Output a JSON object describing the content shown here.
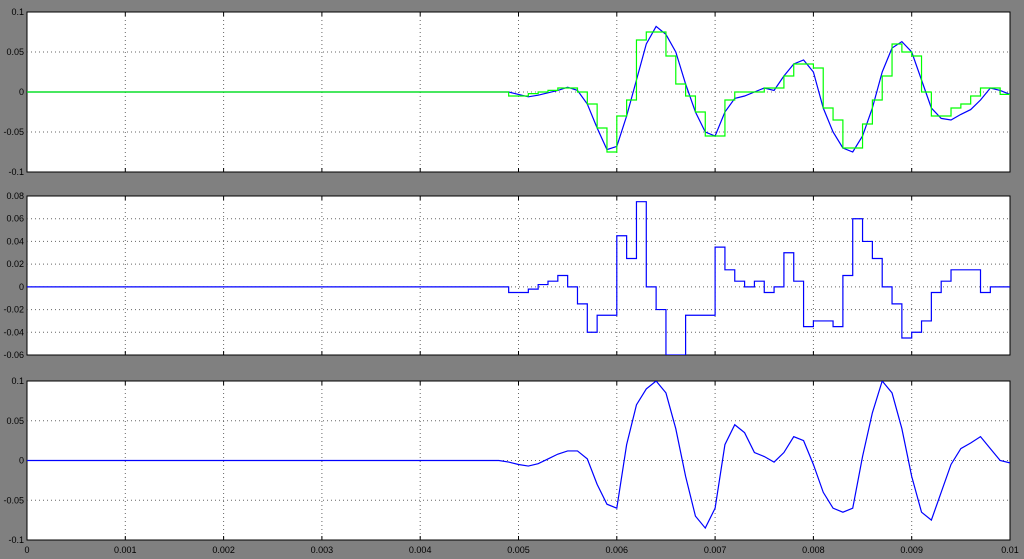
{
  "colors": {
    "background": "#808080",
    "plot_bg": "#ffffff",
    "grid": "#666666",
    "blue": "#0000ff",
    "green": "#00ff00"
  },
  "chart_data": [
    {
      "type": "line",
      "title": "",
      "xlim": [
        0,
        0.01
      ],
      "ylim": [
        -0.1,
        0.1
      ],
      "yticks": [
        "0.1",
        "0.05",
        "0",
        "-0.05",
        "-0.1"
      ],
      "ytick_values": [
        0.1,
        0.05,
        0,
        -0.05,
        -0.1
      ],
      "xticks": [
        0,
        0.001,
        0.002,
        0.003,
        0.004,
        0.005,
        0.006,
        0.007,
        0.008,
        0.009,
        0.01
      ],
      "grid": true,
      "series": [
        {
          "style": "line",
          "color": "#0000ff",
          "x": [
            0,
            0.0005,
            0.001,
            0.002,
            0.003,
            0.004,
            0.0048,
            0.0049,
            0.005,
            0.0051,
            0.0052,
            0.0053,
            0.0054,
            0.0055,
            0.0056,
            0.0057,
            0.0058,
            0.0059,
            0.006,
            0.0061,
            0.0062,
            0.0063,
            0.0064,
            0.0065,
            0.0066,
            0.0067,
            0.0068,
            0.0069,
            0.007,
            0.0071,
            0.0072,
            0.0073,
            0.0074,
            0.0075,
            0.0076,
            0.0077,
            0.0078,
            0.0079,
            0.008,
            0.0081,
            0.0082,
            0.0083,
            0.0084,
            0.0085,
            0.0086,
            0.0087,
            0.0088,
            0.0089,
            0.009,
            0.0091,
            0.0092,
            0.0093,
            0.0094,
            0.0095,
            0.0096,
            0.0097,
            0.0098,
            0.0099,
            0.01
          ],
          "y": [
            0,
            0,
            0,
            0,
            0,
            0,
            0,
            0,
            -0.003,
            -0.006,
            -0.004,
            -0.001,
            0.002,
            0.006,
            0.002,
            -0.015,
            -0.045,
            -0.072,
            -0.068,
            -0.03,
            0.015,
            0.06,
            0.082,
            0.072,
            0.05,
            0.01,
            -0.025,
            -0.05,
            -0.055,
            -0.025,
            -0.008,
            -0.005,
            0,
            0.005,
            0.002,
            0.02,
            0.035,
            0.04,
            0.025,
            -0.02,
            -0.05,
            -0.07,
            -0.075,
            -0.055,
            -0.02,
            0.025,
            0.055,
            0.063,
            0.05,
            0.015,
            -0.02,
            -0.033,
            -0.035,
            -0.028,
            -0.022,
            -0.01,
            0.005,
            0.002,
            -0.003
          ]
        },
        {
          "style": "step",
          "color": "#00ff00",
          "x": [
            0,
            0.004,
            0.0049,
            0.005,
            0.0051,
            0.0052,
            0.0053,
            0.0054,
            0.0055,
            0.0056,
            0.0057,
            0.0058,
            0.0059,
            0.006,
            0.0061,
            0.0062,
            0.0063,
            0.0064,
            0.0065,
            0.0066,
            0.0067,
            0.0068,
            0.0069,
            0.007,
            0.0071,
            0.0072,
            0.0073,
            0.0074,
            0.0075,
            0.0076,
            0.0077,
            0.0078,
            0.0079,
            0.008,
            0.0081,
            0.0082,
            0.0083,
            0.0084,
            0.0085,
            0.0086,
            0.0087,
            0.0088,
            0.0089,
            0.009,
            0.0091,
            0.0092,
            0.0093,
            0.0094,
            0.0095,
            0.0096,
            0.0097,
            0.0098,
            0.0099
          ],
          "y": [
            0,
            0,
            -0.005,
            -0.005,
            -0.002,
            0,
            0.002,
            0.005,
            0.005,
            0,
            -0.015,
            -0.045,
            -0.075,
            -0.03,
            -0.01,
            0.065,
            0.075,
            0.075,
            0.045,
            0.01,
            -0.005,
            -0.025,
            -0.055,
            -0.055,
            -0.01,
            0,
            0,
            0,
            0.005,
            0.005,
            0.02,
            0.035,
            0.035,
            0.03,
            -0.02,
            -0.035,
            -0.07,
            -0.07,
            -0.04,
            -0.01,
            0.02,
            0.06,
            0.05,
            0.045,
            0,
            -0.03,
            -0.03,
            -0.02,
            -0.015,
            -0.005,
            0.005,
            0.005,
            -0.003
          ]
        }
      ]
    },
    {
      "type": "line",
      "title": "",
      "xlim": [
        0,
        0.01
      ],
      "ylim": [
        -0.06,
        0.08
      ],
      "yticks": [
        "0.08",
        "0.06",
        "0.04",
        "0.02",
        "0",
        "-0.02",
        "-0.04",
        "-0.06"
      ],
      "ytick_values": [
        0.08,
        0.06,
        0.04,
        0.02,
        0,
        -0.02,
        -0.04,
        -0.06
      ],
      "xticks": [
        0,
        0.001,
        0.002,
        0.003,
        0.004,
        0.005,
        0.006,
        0.007,
        0.008,
        0.009,
        0.01
      ],
      "grid": true,
      "series": [
        {
          "style": "step",
          "color": "#0000ff",
          "x": [
            0,
            0.0049,
            0.005,
            0.0051,
            0.0052,
            0.0053,
            0.0054,
            0.0055,
            0.0056,
            0.0057,
            0.0058,
            0.0059,
            0.006,
            0.0061,
            0.0062,
            0.0063,
            0.0064,
            0.0065,
            0.0066,
            0.0067,
            0.0068,
            0.0069,
            0.007,
            0.0071,
            0.0072,
            0.0073,
            0.0074,
            0.0075,
            0.0076,
            0.0077,
            0.0078,
            0.0079,
            0.008,
            0.0081,
            0.0082,
            0.0083,
            0.0084,
            0.0085,
            0.0086,
            0.0087,
            0.0088,
            0.0089,
            0.009,
            0.0091,
            0.0092,
            0.0093,
            0.0094,
            0.0095,
            0.0096,
            0.0097,
            0.0098,
            0.0099,
            0.01
          ],
          "y": [
            0,
            -0.005,
            -0.005,
            -0.002,
            0.002,
            0.005,
            0.01,
            0.0,
            -0.015,
            -0.04,
            -0.025,
            -0.025,
            0.045,
            0.025,
            0.075,
            0.0,
            -0.02,
            -0.06,
            -0.06,
            -0.025,
            -0.025,
            -0.025,
            0.035,
            0.015,
            0.005,
            0.0,
            0.005,
            -0.005,
            0.0,
            0.03,
            0.005,
            -0.035,
            -0.03,
            -0.03,
            -0.035,
            0.01,
            0.06,
            0.04,
            0.025,
            0.0,
            -0.015,
            -0.045,
            -0.04,
            -0.03,
            -0.005,
            0.005,
            0.015,
            0.015,
            0.015,
            -0.005,
            0.0,
            0.0,
            0.0
          ]
        }
      ]
    },
    {
      "type": "line",
      "title": "",
      "xlim": [
        0,
        0.01
      ],
      "ylim": [
        -0.1,
        0.1
      ],
      "yticks": [
        "0.1",
        "0.05",
        "0",
        "-0.05",
        "-0.1"
      ],
      "ytick_values": [
        0.1,
        0.05,
        0,
        -0.05,
        -0.1
      ],
      "xticks": [
        0,
        0.001,
        0.002,
        0.003,
        0.004,
        0.005,
        0.006,
        0.007,
        0.008,
        0.009,
        0.01
      ],
      "xticklabels": [
        "0",
        "0.001",
        "0.002",
        "0.003",
        "0.004",
        "0.005",
        "0.006",
        "0.007",
        "0.008",
        "0.009",
        "0.01"
      ],
      "grid": true,
      "series": [
        {
          "style": "line",
          "color": "#0000ff",
          "x": [
            0,
            0.0048,
            0.0049,
            0.005,
            0.0051,
            0.0052,
            0.0053,
            0.0054,
            0.0055,
            0.0056,
            0.0057,
            0.0058,
            0.0059,
            0.006,
            0.0061,
            0.0062,
            0.0063,
            0.0064,
            0.0065,
            0.0066,
            0.0067,
            0.0068,
            0.0069,
            0.007,
            0.0071,
            0.0072,
            0.0073,
            0.0074,
            0.0075,
            0.0076,
            0.0077,
            0.0078,
            0.0079,
            0.008,
            0.0081,
            0.0082,
            0.0083,
            0.0084,
            0.0085,
            0.0086,
            0.0087,
            0.0088,
            0.0089,
            0.009,
            0.0091,
            0.0092,
            0.0093,
            0.0094,
            0.0095,
            0.0096,
            0.0097,
            0.0098,
            0.0099,
            0.01
          ],
          "y": [
            0,
            0,
            -0.002,
            -0.005,
            -0.007,
            -0.004,
            0.002,
            0.008,
            0.012,
            0.012,
            0.002,
            -0.03,
            -0.055,
            -0.06,
            0.02,
            0.07,
            0.09,
            0.1,
            0.085,
            0.04,
            -0.02,
            -0.07,
            -0.085,
            -0.06,
            0.02,
            0.045,
            0.035,
            0.01,
            0.005,
            -0.002,
            0.01,
            0.03,
            0.025,
            -0.005,
            -0.04,
            -0.06,
            -0.065,
            -0.06,
            0.005,
            0.06,
            0.1,
            0.085,
            0.04,
            -0.02,
            -0.065,
            -0.075,
            -0.04,
            -0.005,
            0.015,
            0.022,
            0.03,
            0.015,
            0.0,
            -0.003
          ]
        }
      ]
    }
  ]
}
